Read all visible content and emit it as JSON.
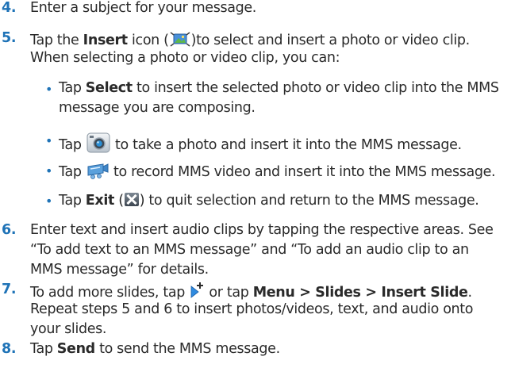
{
  "steps": {
    "s4": {
      "num": "4.",
      "text": "Enter a subject for your message."
    },
    "s5": {
      "num": "5.",
      "l1_a": "Tap the ",
      "l1_b": "Insert",
      "l1_c": " icon (",
      "l1_d": ")to select and insert a photo or video clip.",
      "l2": "When selecting a photo or video clip, you can:",
      "b1_a": "Tap ",
      "b1_b": "Select",
      "b1_c": " to insert the selected photo or video clip into the MMS",
      "b1_l2": "message you are composing.",
      "b2_a": "Tap ",
      "b2_b": " to take a photo and insert it into the MMS message.",
      "b3_a": "Tap ",
      "b3_b": " to record MMS video and insert it into the MMS message.",
      "b4_a": "Tap ",
      "b4_b": "Exit",
      "b4_c": " (",
      "b4_d": ") to quit selection and return to the MMS message."
    },
    "s6": {
      "num": "6.",
      "l1": "Enter text and insert audio clips by tapping the respective areas. See",
      "l2": "“To add text to an MMS message” and “To add an audio clip to an",
      "l3": "MMS message” for details."
    },
    "s7": {
      "num": "7.",
      "l1_a": "To add more slides, tap ",
      "l1_b": " or tap ",
      "l1_c": "Menu > Slides > Insert Slide",
      "l1_d": ".",
      "l2": "Repeat steps 5 and 6 to insert photos/videos, text, and audio onto",
      "l3": "your slides."
    },
    "s8": {
      "num": "8.",
      "a": "Tap ",
      "b": "Send",
      "c": " to send the MMS message."
    }
  },
  "bullet_char": "•",
  "icons": {
    "insert": "insert-media-icon",
    "camera": "camera-icon",
    "video": "video-camera-icon",
    "exit": "exit-x-icon",
    "add_slide": "add-slide-icon"
  },
  "colors": {
    "step_number": "#1f73b7",
    "text": "#2a2a2a"
  }
}
